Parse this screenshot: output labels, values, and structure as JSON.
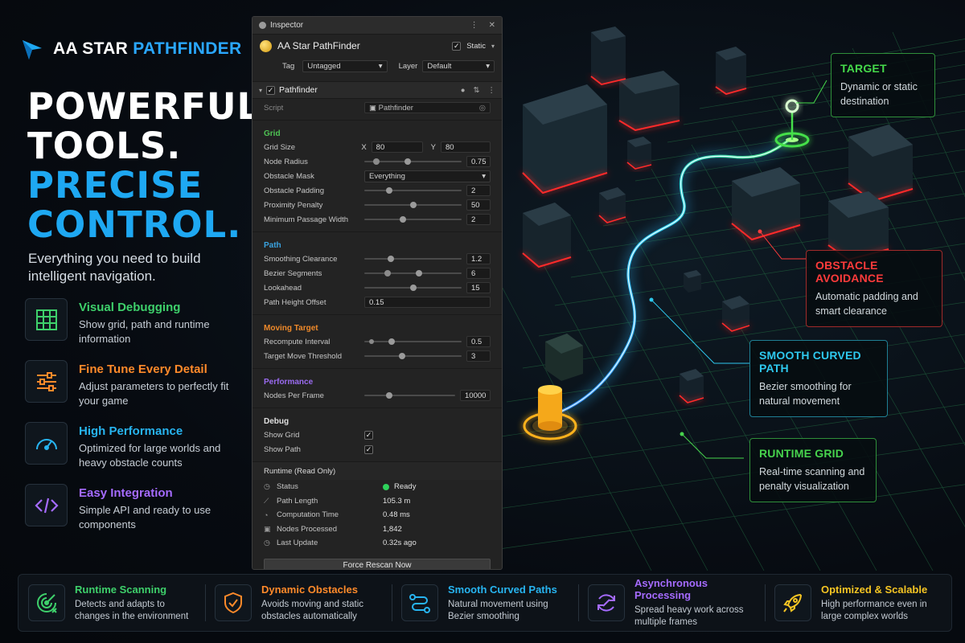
{
  "brand": {
    "name_a": "AA STAR",
    "name_b": "PATHFINDER",
    "logo_icon": "star-arrow-icon"
  },
  "headline": {
    "line1": "POWERFUL",
    "line2": "TOOLS.",
    "line3": "PRECISE",
    "line4": "CONTROL."
  },
  "tagline": "Everything you need to build intelligent navigation.",
  "features": [
    {
      "title": "Visual Debugging",
      "desc": "Show grid, path and runtime information",
      "color": "#3ed06b",
      "icon": "grid-icon"
    },
    {
      "title": "Fine Tune Every Detail",
      "desc": "Adjust parameters to perfectly fit your game",
      "color": "#ff8a2a",
      "icon": "sliders-icon"
    },
    {
      "title": "High Performance",
      "desc": "Optimized for large worlds and heavy obstacle counts",
      "color": "#27b4f0",
      "icon": "speedometer-icon"
    },
    {
      "title": "Easy Integration",
      "desc": "Simple API and ready to use components",
      "color": "#a56bff",
      "icon": "code-icon"
    }
  ],
  "inspector": {
    "title": "Inspector",
    "object_name": "AA Star PathFinder",
    "static_label": "Static",
    "tag_label": "Tag",
    "tag_value": "Untagged",
    "layer_label": "Layer",
    "layer_value": "Default",
    "component": "Pathfinder",
    "script_label": "Script",
    "script_value": "Pathfinder",
    "grid": {
      "title": "Grid",
      "grid_size_label": "Grid Size",
      "x_label": "X",
      "x_value": "80",
      "y_label": "Y",
      "y_value": "80",
      "node_radius_label": "Node Radius",
      "node_radius": "0.75",
      "obstacle_mask_label": "Obstacle Mask",
      "obstacle_mask": "Everything",
      "obstacle_padding_label": "Obstacle Padding",
      "obstacle_padding": "2",
      "proximity_penalty_label": "Proximity Penalty",
      "proximity_penalty": "50",
      "min_passage_label": "Minimum Passage Width",
      "min_passage": "2"
    },
    "path": {
      "title": "Path",
      "smoothing_label": "Smoothing Clearance",
      "smoothing": "1.2",
      "bezier_label": "Bezier Segments",
      "bezier": "6",
      "lookahead_label": "Lookahead",
      "lookahead": "15",
      "height_label": "Path Height Offset",
      "height": "0.15"
    },
    "moving": {
      "title": "Moving Target",
      "recompute_label": "Recompute Interval",
      "recompute": "0.5",
      "threshold_label": "Target Move Threshold",
      "threshold": "3"
    },
    "performance": {
      "title": "Performance",
      "nodes_label": "Nodes Per Frame",
      "nodes": "10000"
    },
    "debug": {
      "title": "Debug",
      "show_grid_label": "Show Grid",
      "show_path_label": "Show Path"
    },
    "runtime": {
      "title": "Runtime (Read Only)",
      "status_label": "Status",
      "status": "Ready",
      "length_label": "Path Length",
      "length": "105.3 m",
      "time_label": "Computation Time",
      "time": "0.48 ms",
      "nodes_label": "Nodes Processed",
      "nodes": "1,842",
      "update_label": "Last Update",
      "update": "0.32s ago"
    },
    "button": "Force Rescan Now",
    "colors": {
      "grid": "#4fc454",
      "path": "#3aa3e0",
      "moving": "#f08a2a",
      "performance": "#9a6bf0",
      "debug": "#e0e0e0"
    }
  },
  "callouts": {
    "target": {
      "title": "TARGET",
      "desc": "Dynamic or static destination",
      "color": "#45d94a"
    },
    "obstacle": {
      "title": "OBSTACLE AVOIDANCE",
      "desc": "Automatic padding and smart clearance",
      "color": "#ff3b3b"
    },
    "curved": {
      "title": "SMOOTH CURVED PATH",
      "desc": "Bezier smoothing for natural movement",
      "color": "#2ec8ee"
    },
    "grid": {
      "title": "RUNTIME GRID",
      "desc": "Real-time scanning and penalty visualization",
      "color": "#47d34d"
    }
  },
  "bottom": [
    {
      "title": "Runtime Scanning",
      "desc": "Detects and adapts to changes in the environment",
      "color": "#3ed06b",
      "icon": "radar-icon"
    },
    {
      "title": "Dynamic Obstacles",
      "desc": "Avoids moving and static obstacles automatically",
      "color": "#ff8a2a",
      "icon": "shield-check-icon"
    },
    {
      "title": "Smooth Curved Paths",
      "desc": "Natural movement using Bezier smoothing",
      "color": "#27b4f0",
      "icon": "curved-path-icon"
    },
    {
      "title": "Asynchronous Processing",
      "desc": "Spread heavy work across multiple frames",
      "color": "#a56bff",
      "icon": "async-cycle-icon"
    },
    {
      "title": "Optimized & Scalable",
      "desc": "High performance even in large complex worlds",
      "color": "#f5c523",
      "icon": "rocket-icon"
    }
  ]
}
